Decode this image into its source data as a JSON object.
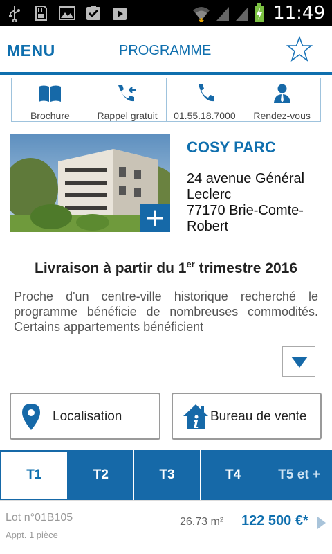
{
  "status_bar": {
    "time": "11:49"
  },
  "header": {
    "menu_label": "MENU",
    "title": "PROGRAMME"
  },
  "actions": [
    {
      "label": "Brochure",
      "icon": "book-icon"
    },
    {
      "label": "Rappel gratuit",
      "icon": "phone-callback-icon"
    },
    {
      "label": "01.55.18.7000",
      "icon": "phone-icon"
    },
    {
      "label": "Rendez-vous",
      "icon": "person-icon"
    }
  ],
  "program": {
    "name": "COSY PARC",
    "address_lines": [
      "24 avenue Général",
      "Leclerc",
      "77170 Brie-Comte-",
      "Robert"
    ],
    "delivery_prefix": "Livraison à partir du 1",
    "delivery_sup": "er",
    "delivery_suffix": " trimestre 2016",
    "description": "Proche d'un centre-ville historique recherché le programme bénéficie de nombreuses commodités. Certains appartements bénéficient"
  },
  "buttons": {
    "localisation": "Localisation",
    "sales_office": "Bureau de vente"
  },
  "tabs": [
    {
      "label": "T1",
      "active": true
    },
    {
      "label": "T2",
      "active": false
    },
    {
      "label": "T3",
      "active": false
    },
    {
      "label": "T4",
      "active": false
    },
    {
      "label": "T5 et +",
      "active": false
    }
  ],
  "lot": {
    "number": "Lot n°01B105",
    "type": "Appt. 1 pièce",
    "area": "26.73 m²",
    "price": "122 500 €*"
  },
  "colors": {
    "brand_blue": "#0f6fae",
    "tab_blue": "#1669a8"
  }
}
